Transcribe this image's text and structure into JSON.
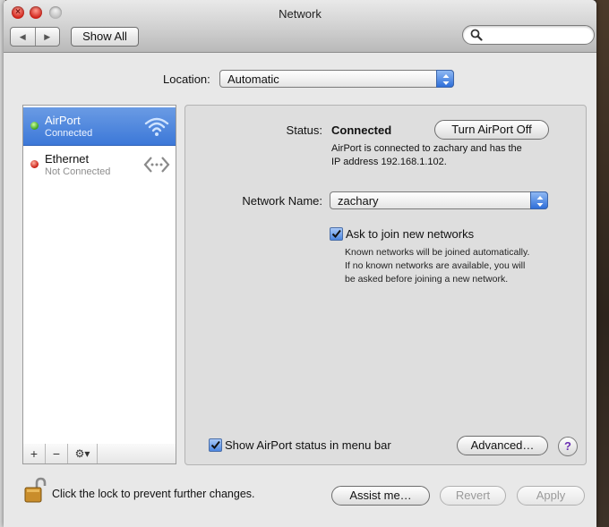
{
  "window": {
    "title": "Network"
  },
  "toolbar": {
    "show_all_label": "Show All",
    "search_placeholder": ""
  },
  "location": {
    "label": "Location:",
    "value": "Automatic"
  },
  "services": [
    {
      "name": "AirPort",
      "status": "Connected",
      "status_color": "#3aa11a",
      "selected": true,
      "icon": "wifi-icon"
    },
    {
      "name": "Ethernet",
      "status": "Not Connected",
      "status_color": "#c81a10",
      "selected": false,
      "icon": "ethernet-icon"
    }
  ],
  "sidebar_tools": {
    "add": "+",
    "remove": "−",
    "action": "⚙▾"
  },
  "detail": {
    "status_label": "Status:",
    "status_value": "Connected",
    "turn_off_label": "Turn AirPort Off",
    "status_desc_line1": "AirPort is connected to zachary and has the",
    "status_desc_line2": "IP address 192.168.1.102.",
    "network_name_label": "Network Name:",
    "network_name_value": "zachary",
    "ask_join_label": "Ask to join new networks",
    "ask_join_checked": true,
    "ask_join_note_line1": "Known networks will be joined automatically.",
    "ask_join_note_line2": "If no known networks are available, you will",
    "ask_join_note_line3": "be asked before joining a new network.",
    "show_status_label": "Show AirPort status in menu bar",
    "show_status_checked": true,
    "advanced_label": "Advanced…",
    "help_label": "?"
  },
  "footer": {
    "lock_text": "Click the lock to prevent further changes.",
    "assist_label": "Assist me…",
    "revert_label": "Revert",
    "apply_label": "Apply"
  },
  "colors": {
    "selection": "#3c78d8",
    "accent": "#2f6fd9"
  }
}
